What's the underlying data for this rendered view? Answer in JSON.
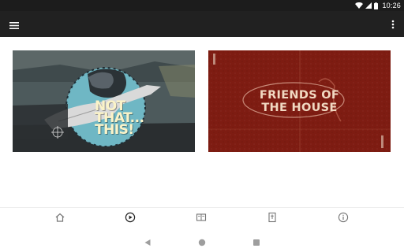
{
  "status_bar": {
    "time": "10:26",
    "icons": [
      "wifi-icon",
      "signal-icon",
      "battery-icon"
    ]
  },
  "app_bar": {
    "background": "#212121",
    "icons": [
      "menu-icon",
      "more-vert-icon"
    ]
  },
  "cards": [
    {
      "title": "NOT\nTHAT...\nTHIS!",
      "theme": [
        "#4a5659",
        "#6fb7c4",
        "#fbf3c8"
      ]
    },
    {
      "title": "FRIENDS OF\nTHE HOUSE",
      "theme": [
        "#7e1c12",
        "#f1d9c2"
      ]
    }
  ],
  "bottom_nav": {
    "items": [
      "home-icon",
      "play-circle-icon",
      "book-icon",
      "bible-icon",
      "info-icon"
    ],
    "active_color": "#212121",
    "inactive_color": "#757575"
  },
  "system_nav": {
    "buttons": [
      "back-icon",
      "home-circle-icon",
      "recents-icon"
    ]
  }
}
